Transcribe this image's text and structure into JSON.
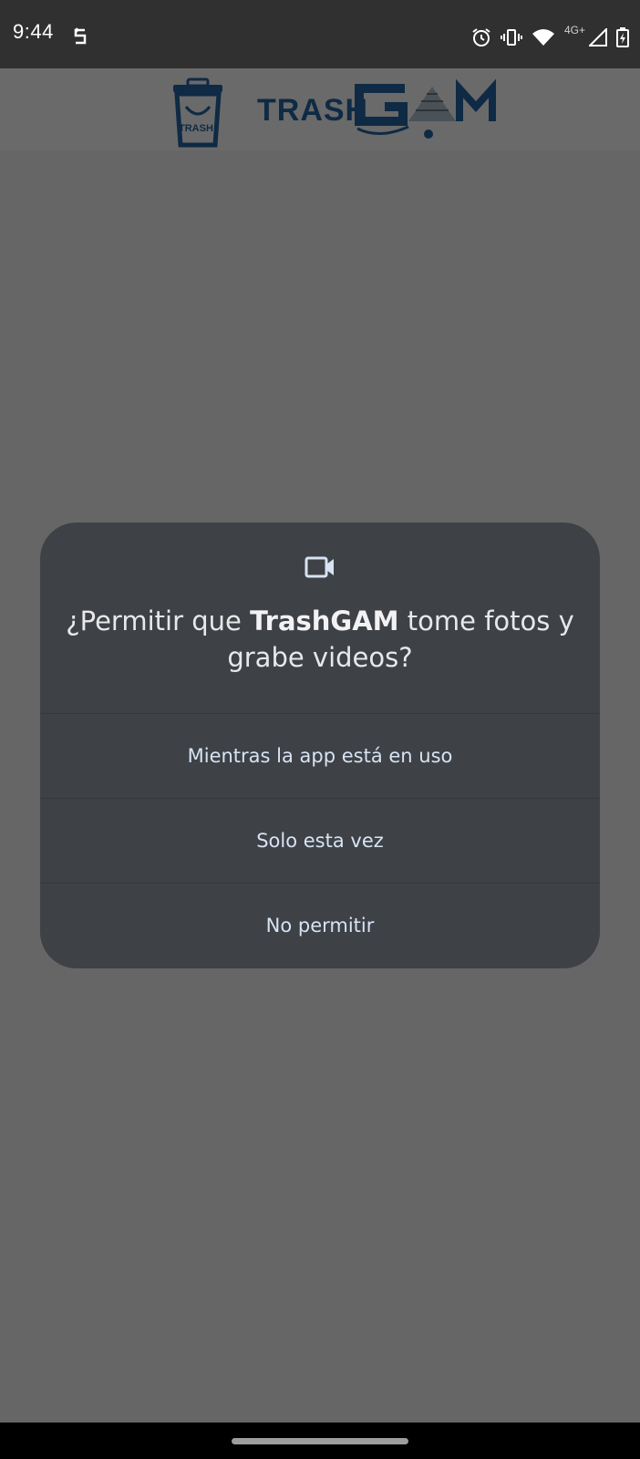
{
  "status_bar": {
    "time": "9:44",
    "network_label": "4G+",
    "icons": [
      "sync-icon",
      "alarm-icon",
      "vibrate-icon",
      "wifi-icon",
      "cell-signal-icon",
      "battery-charging-icon"
    ]
  },
  "header": {
    "logo_text": "TRASH",
    "logo_badge": "TRASH",
    "logo_brand_color": "#0f2a44"
  },
  "dialog": {
    "icon": "videocam-icon",
    "title_before": "¿Permitir que ",
    "title_app": "TrashGAM",
    "title_after": " tome fotos y grabe videos?",
    "options": [
      {
        "label": "Mientras la app está en uso"
      },
      {
        "label": "Solo esta vez"
      },
      {
        "label": "No permitir"
      }
    ],
    "background_color": "#3e4145",
    "option_text_color": "#d7e3f4"
  },
  "colors": {
    "status_bar": "#303030",
    "scrim": "#666666",
    "nav_bar": "#000000"
  }
}
